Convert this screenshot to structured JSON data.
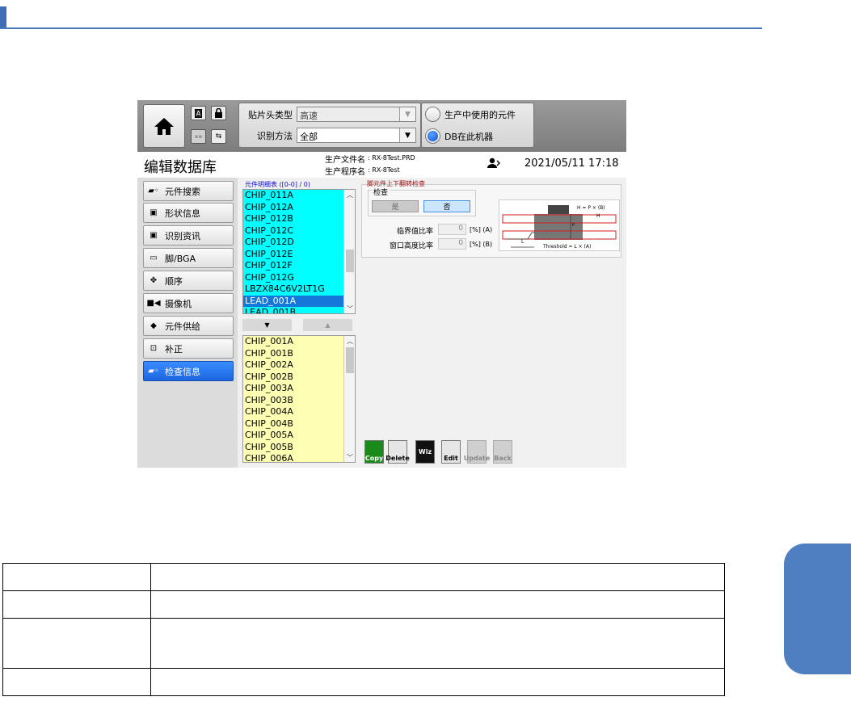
{
  "toolbar": {
    "head_type_label": "贴片头类型",
    "head_type_value": "高速",
    "recog_method_label": "识别方法",
    "recog_method_value": "全部",
    "radio_in_use": "生产中使用的元件",
    "radio_db_machine": "DB在此机器",
    "radio_selected": "DB在此机器"
  },
  "info": {
    "title": "编辑数据库",
    "file_label": "生产文件名",
    "file_value": ": RX-8Test.PRD",
    "program_label": "生产程序名",
    "program_value": ": RX-8Test",
    "datetime": "2021/05/11 17:18"
  },
  "menu": [
    {
      "label": "元件搜索",
      "icon": "component-search-icon"
    },
    {
      "label": "形状信息",
      "icon": "shape-icon"
    },
    {
      "label": "识别资讯",
      "icon": "recognition-icon"
    },
    {
      "label": "脚/BGA",
      "icon": "lead-bga-icon"
    },
    {
      "label": "顺序",
      "icon": "sequence-icon"
    },
    {
      "label": "摄像机",
      "icon": "camera-icon"
    },
    {
      "label": "元件供给",
      "icon": "feeder-icon"
    },
    {
      "label": "补正",
      "icon": "correction-icon"
    },
    {
      "label": "检查信息",
      "icon": "inspection-icon",
      "active": true
    }
  ],
  "list_upper": {
    "label": "元件明细表 ([0-0] / 0)",
    "items": [
      "CHIP_011A",
      "CHIP_012A",
      "CHIP_012B",
      "CHIP_012C",
      "CHIP_012D",
      "CHIP_012E",
      "CHIP_012F",
      "CHIP_012G",
      "LBZX84C6V2LT1G",
      "LEAD_001A",
      "LEAD_001B"
    ],
    "selected": "LEAD_001A"
  },
  "move_buttons": {
    "down": "▼",
    "up": "▲"
  },
  "list_lower": {
    "items": [
      "CHIP_001A",
      "CHIP_001B",
      "CHIP_002A",
      "CHIP_002B",
      "CHIP_003A",
      "CHIP_003B",
      "CHIP_004A",
      "CHIP_004B",
      "CHIP_005A",
      "CHIP_005B",
      "CHIP_006A"
    ]
  },
  "inspection": {
    "panel_title": "脚元件上下翻转检查",
    "check_label": "检查",
    "yes": "是",
    "no": "否",
    "selected": "否",
    "critical_label": "临界值比率",
    "critical_value": "0",
    "critical_unit": "[%] (A)",
    "window_label": "窗口高度比率",
    "window_value": "0",
    "window_unit": "[%] (B)",
    "diagram_formula_h": "H = P × (B)",
    "diagram_h": "H",
    "diagram_p": "P",
    "diagram_l": "L",
    "diagram_threshold": "Threshold = L × (A)"
  },
  "tools": [
    {
      "label": "Copy",
      "enabled": true
    },
    {
      "label": "Delete",
      "enabled": true
    },
    {
      "label": "Wiz",
      "enabled": true
    },
    {
      "label": "Edit",
      "enabled": true
    },
    {
      "label": "Update",
      "enabled": false
    },
    {
      "label": "Back",
      "enabled": false
    }
  ],
  "colors": {
    "accent": "#4f7fc1",
    "list_upper_bg": "#00ffff",
    "list_lower_bg": "#ffffb4",
    "selected": "#1478d8"
  }
}
